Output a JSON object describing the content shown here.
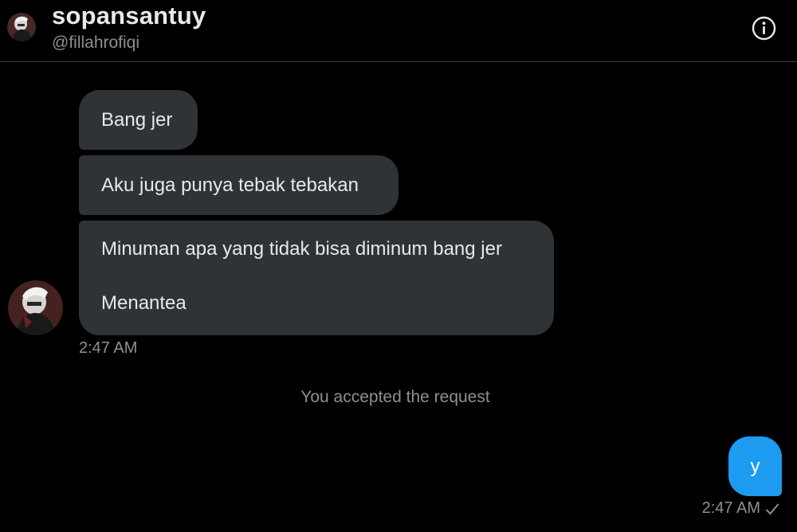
{
  "header": {
    "display_name": "sopansantuy",
    "handle": "@fillahrofiqi",
    "info_icon": "info-icon"
  },
  "conversation": {
    "incoming": [
      {
        "text": "Bang jer"
      },
      {
        "text": "Aku juga punya tebak tebakan"
      },
      {
        "lines": [
          "Minuman apa yang tidak bisa diminum bang jer",
          "Menantea"
        ]
      }
    ],
    "incoming_time": "2:47 AM",
    "system_message": "You accepted the request",
    "outgoing": [
      {
        "text": "y"
      }
    ],
    "outgoing_time": "2:47 AM",
    "read_status_icon": "checkmark-icon"
  },
  "colors": {
    "background": "#000000",
    "incoming_bubble": "#2f3336",
    "outgoing_bubble": "#1d9bf0",
    "secondary_text": "#8b9095",
    "divider": "#3a3d40"
  }
}
